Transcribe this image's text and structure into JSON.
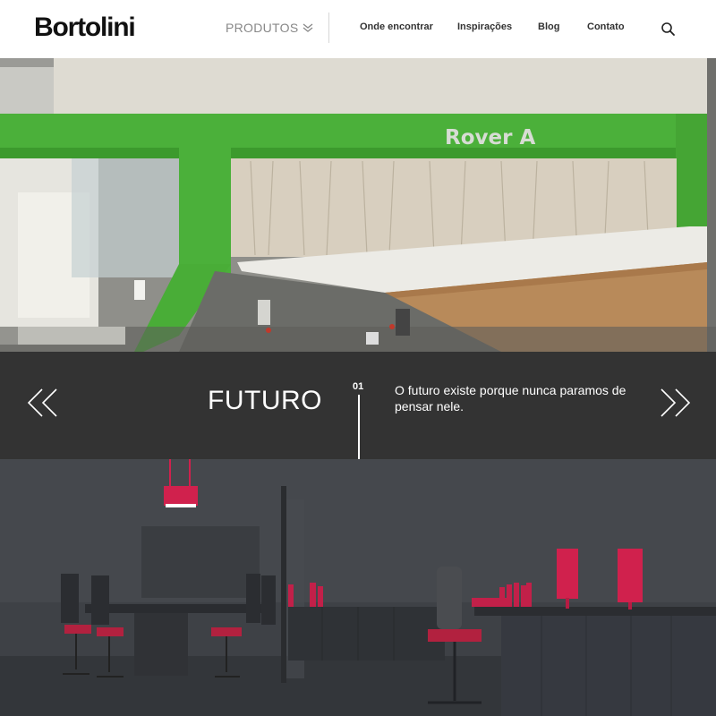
{
  "header": {
    "logo": "Bortolini",
    "produtos_label": "PRODUTOS",
    "nav": [
      "Onde encontrar",
      "Inspirações",
      "Blog",
      "Contato"
    ],
    "search_icon": "search-icon"
  },
  "hero": {
    "machine_label": "Rover A"
  },
  "slider": {
    "title": "FUTURO",
    "number": "01",
    "description": "O futuro existe porque nunca paramos de pensar nele.",
    "prev_icon": "double-chevron-left-icon",
    "next_icon": "double-chevron-right-icon"
  },
  "colors": {
    "machine_green": "#4bb03a",
    "slider_bg": "#333333",
    "accent_red": "#d0214d"
  }
}
